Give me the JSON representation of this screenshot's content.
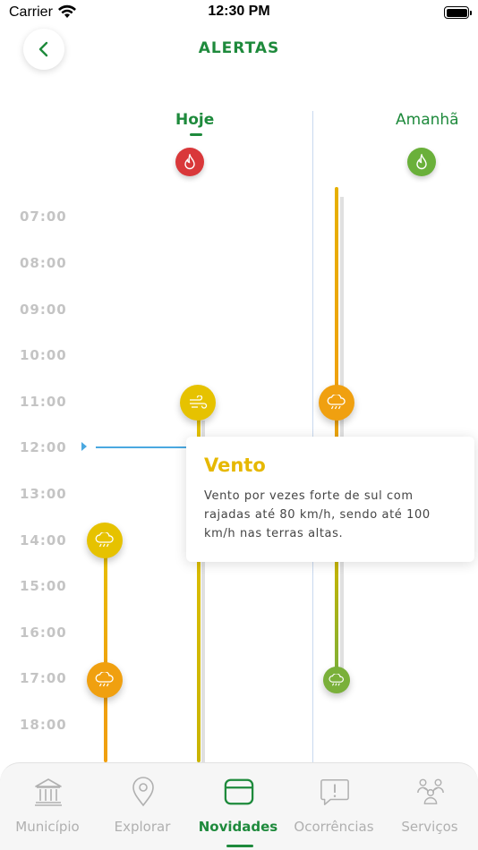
{
  "status_bar": {
    "carrier": "Carrier",
    "time": "12:30 PM"
  },
  "header": {
    "title": "ALERTAS"
  },
  "days": {
    "today": "Hoje",
    "tomorrow": "Amanhã"
  },
  "hours": [
    "07:00",
    "08:00",
    "09:00",
    "10:00",
    "11:00",
    "12:00",
    "13:00",
    "14:00",
    "15:00",
    "16:00",
    "17:00",
    "18:00"
  ],
  "popup": {
    "title": "Vento",
    "text": "Vento por vezes forte de sul com rajadas até 80 km/h, sendo até 100 km/h nas terras altas."
  },
  "colors": {
    "green": "#1e8a3c",
    "yellow": "#e6c200",
    "orange": "#f0a010",
    "red": "#d9383a",
    "light_green": "#6ab03a",
    "now_blue": "#4aa8e0"
  },
  "tabs": [
    {
      "label": "Município",
      "icon": "bank-icon"
    },
    {
      "label": "Explorar",
      "icon": "map-pin-icon"
    },
    {
      "label": "Novidades",
      "icon": "window-icon",
      "active": true
    },
    {
      "label": "Ocorrências",
      "icon": "speech-alert-icon"
    },
    {
      "label": "Serviços",
      "icon": "people-icon"
    }
  ]
}
